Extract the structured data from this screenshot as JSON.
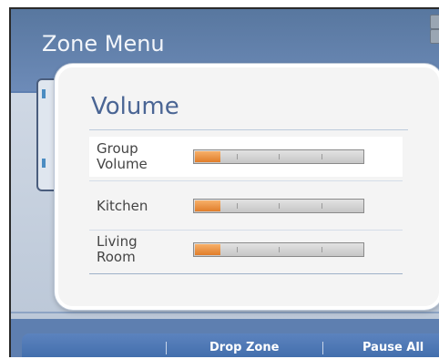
{
  "app": {
    "title": "Zone Menu"
  },
  "bottom_bar": {
    "drop_zone_label": "Drop Zone",
    "pause_all_label": "Pause All"
  },
  "popup": {
    "title": "Volume",
    "rows": [
      {
        "label": "Group\nVolume",
        "level": 0.15,
        "selected": true
      },
      {
        "label": "Kitchen",
        "level": 0.15,
        "selected": false
      },
      {
        "label": "Living\nRoom",
        "level": 0.15,
        "selected": false
      }
    ]
  },
  "colors": {
    "accent": "#e9883a",
    "title": "#4a6594",
    "header_bg": "#6283b2",
    "bar_bg": "#3d6aa9"
  }
}
